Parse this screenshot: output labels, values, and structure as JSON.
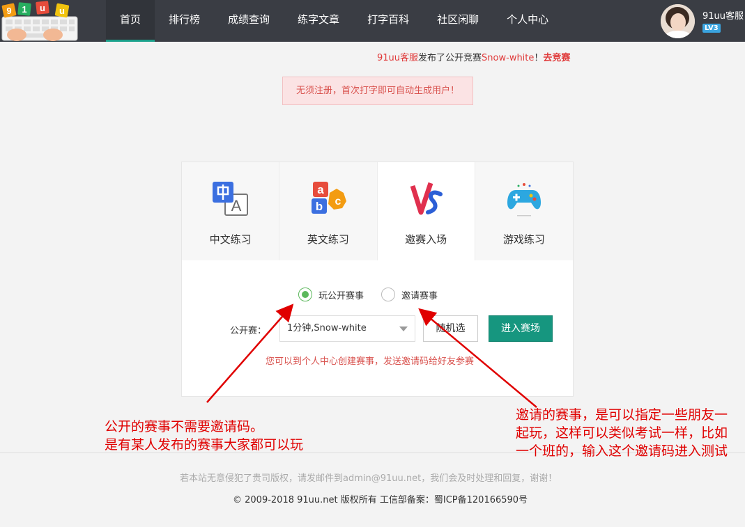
{
  "nav": {
    "logo_text": "91uu",
    "items": [
      {
        "label": "首页",
        "active": true
      },
      {
        "label": "排行榜"
      },
      {
        "label": "成绩查询"
      },
      {
        "label": "练字文章"
      },
      {
        "label": "打字百科"
      },
      {
        "label": "社区闲聊"
      },
      {
        "label": "个人中心"
      }
    ],
    "user": {
      "name": "91uu客服",
      "level": "LV3"
    }
  },
  "announcement": {
    "user": "91uu客服",
    "text1": "发布了公开竞赛",
    "contest": "Snow-white",
    "text2": "！",
    "action": "去竞赛"
  },
  "notice": "无须注册，首次打字即可自动生成用户！",
  "tabs": [
    {
      "label": "中文练习",
      "icon": "chinese-icon"
    },
    {
      "label": "英文练习",
      "icon": "abc-blocks-icon"
    },
    {
      "label": "邀赛入场",
      "icon": "vs-icon",
      "active": true
    },
    {
      "label": "游戏练习",
      "icon": "gamepad-icon"
    }
  ],
  "contest": {
    "radio_public": "玩公开赛事",
    "radio_invite": "邀请赛事",
    "select_label": "公开赛：",
    "select_value": "1分钟,Snow-white",
    "random_button": "随机选",
    "enter_button": "进入赛场",
    "hint": "您可以到个人中心创建赛事，发送邀请码给好友参赛"
  },
  "footer": {
    "line1": "若本站无意侵犯了贵司版权，请发邮件到admin@91uu.net，我们会及时处理和回复，谢谢！",
    "line2": "© 2009-2018 91uu.net 版权所有 工信部备案：蜀ICP备120166590号"
  },
  "annotations": {
    "left_line1": "公开的赛事不需要邀请码。",
    "left_line2": "是有某人发布的赛事大家都可以玩",
    "right_text": "邀请的赛事，是可以指定一些朋友一起玩，这样可以类似考试一样，比如一个班的，输入这个邀请码进入测试"
  },
  "colors": {
    "nav_bg": "#3a3d44",
    "accent": "#16967f",
    "red": "#e03a3a",
    "annotation": "#e00000"
  }
}
